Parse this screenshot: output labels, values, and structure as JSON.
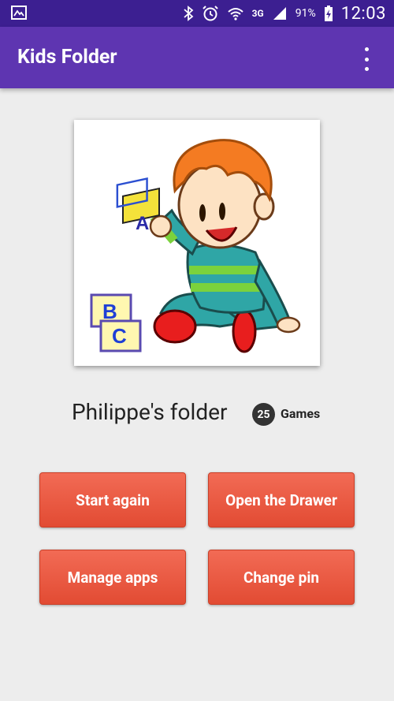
{
  "status_bar": {
    "battery_percent": "91%",
    "network": "3G",
    "time": "12:03"
  },
  "app_bar": {
    "title": "Kids Folder"
  },
  "folder": {
    "name": "Philippe's folder",
    "games_count": "25",
    "games_label": "Games"
  },
  "buttons": {
    "start_again": "Start again",
    "open_drawer": "Open the Drawer",
    "manage_apps": "Manage apps",
    "change_pin": "Change pin"
  },
  "colors": {
    "status_bar": "#3c1f91",
    "app_bar": "#5e35b1",
    "button": "#e8573f",
    "background": "#ededed"
  },
  "block_letters": [
    "A",
    "B",
    "C"
  ]
}
